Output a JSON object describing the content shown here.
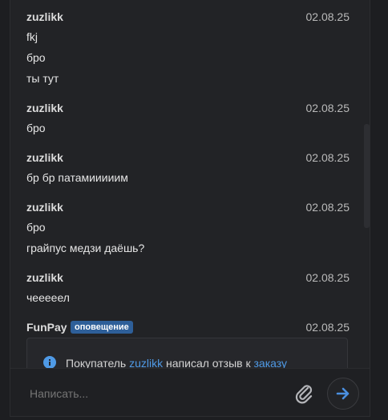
{
  "messages": [
    {
      "author": "zuzlikk",
      "date": "02.08.25",
      "lines": [
        "fkj",
        "бро",
        "ты тут"
      ]
    },
    {
      "author": "zuzlikk",
      "date": "02.08.25",
      "lines": [
        "бро"
      ]
    },
    {
      "author": "zuzlikk",
      "date": "02.08.25",
      "lines": [
        "бр бр патамииииим"
      ]
    },
    {
      "author": "zuzlikk",
      "date": "02.08.25",
      "lines": [
        "бро",
        "грайпус медзи даёшь?"
      ]
    },
    {
      "author": "zuzlikk",
      "date": "02.08.25",
      "lines": [
        "чееееел"
      ]
    }
  ],
  "system_message": {
    "author": "FunPay",
    "badge": "оповещение",
    "date": "02.08.25",
    "notice": {
      "prefix": "Покупатель ",
      "user_link": "zuzlikk",
      "middle": " написал отзыв к ",
      "order_link": "заказу"
    }
  },
  "composer": {
    "placeholder": "Написать..."
  },
  "icons": {
    "info": "info-circle-icon",
    "attach": "paperclip-icon",
    "send": "arrow-right-icon"
  },
  "colors": {
    "background": "#1d1e21",
    "panel": "#222326",
    "link": "#4f9ae6",
    "badge": "#2e5f99",
    "send_arrow": "#4a8fe0"
  }
}
